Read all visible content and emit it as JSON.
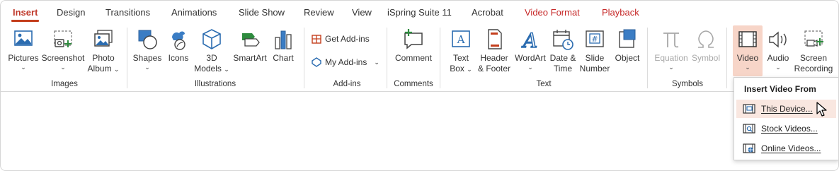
{
  "tabs": [
    {
      "label": "Insert",
      "active": true
    },
    {
      "label": "Design"
    },
    {
      "label": "Transitions"
    },
    {
      "label": "Animations"
    },
    {
      "label": "Slide Show"
    },
    {
      "label": "Review"
    },
    {
      "label": "View"
    },
    {
      "label": "iSpring Suite 11"
    },
    {
      "label": "Acrobat"
    },
    {
      "label": "Video Format",
      "contextual": true
    },
    {
      "label": "Playback",
      "contextual": true
    }
  ],
  "groups": {
    "images": {
      "label": "Images",
      "pictures": {
        "line1": "Pictures"
      },
      "screenshot": {
        "line1": "Screenshot"
      },
      "photo_album": {
        "line1": "Photo",
        "line2": "Album"
      }
    },
    "illustrations": {
      "label": "Illustrations",
      "shapes": {
        "line1": "Shapes"
      },
      "icons": {
        "line1": "Icons"
      },
      "models3d": {
        "line1": "3D",
        "line2": "Models"
      },
      "smartart": {
        "line1": "SmartArt"
      },
      "chart": {
        "line1": "Chart"
      }
    },
    "addins": {
      "label": "Add-ins",
      "get": "Get Add-ins",
      "my": "My Add-ins"
    },
    "comments": {
      "label": "Comments",
      "comment": {
        "line1": "Comment"
      }
    },
    "text": {
      "label": "Text",
      "textbox": {
        "line1": "Text",
        "line2": "Box"
      },
      "header_footer": {
        "line1": "Header",
        "line2": "& Footer"
      },
      "wordart": {
        "line1": "WordArt"
      },
      "date_time": {
        "line1": "Date &",
        "line2": "Time"
      },
      "slide_number": {
        "line1": "Slide",
        "line2": "Number"
      },
      "object": {
        "line1": "Object"
      }
    },
    "symbols": {
      "label": "Symbols",
      "equation": {
        "line1": "Equation"
      },
      "symbol": {
        "line1": "Symbol"
      }
    },
    "media": {
      "video": {
        "line1": "Video"
      },
      "audio": {
        "line1": "Audio"
      },
      "screen_recording": {
        "line1": "Screen",
        "line2": "Recording"
      }
    }
  },
  "video_menu": {
    "header": "Insert Video From",
    "items": [
      {
        "label": "This Device...",
        "hovered": true
      },
      {
        "label": "Stock Videos..."
      },
      {
        "label": "Online Videos..."
      }
    ]
  },
  "colors": {
    "accent": "#c43e1c",
    "contextual_tab": "#c62828",
    "video_highlight": "#f7d5c8",
    "icon_blue": "#2b6cb0",
    "icon_green": "#2e8b3e"
  }
}
